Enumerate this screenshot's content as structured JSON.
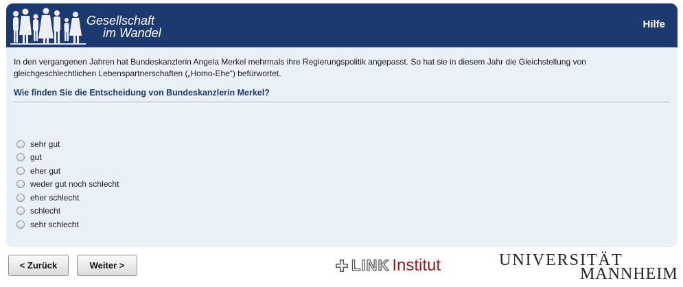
{
  "header": {
    "logo_line1": "Gesellschaft",
    "logo_line2": "im Wandel",
    "help_label": "Hilfe"
  },
  "question": {
    "intro": "In den vergangenen Jahren hat Bundeskanzlerin Angela Merkel mehrmals ihre Regierungspolitik angepasst. So hat sie in diesem Jahr die Gleichstellung von gleichgeschlechtlichen Lebenspartnerschaften („Homo-Ehe“) befürwortet.",
    "text": "Wie finden Sie die Entscheidung von Bundeskanzlerin Merkel?",
    "options": [
      "sehr gut",
      "gut",
      "eher gut",
      "weder gut noch schlecht",
      "eher schlecht",
      "schlecht",
      "sehr schlecht"
    ]
  },
  "nav": {
    "back_label": "< Zurück",
    "next_label": "Weiter >"
  },
  "footer": {
    "link_word": "LINK",
    "institut_word": "Institut",
    "uni_line1": "UNIVERSITÄT",
    "uni_line2": "MANNHEIM"
  },
  "colors": {
    "header_bg": "#1d3a6e",
    "panel_bg": "#e9f0f8",
    "question_text": "#1d3a6e",
    "institut_red": "#8a1c1c"
  },
  "icons": {
    "logo": "people-silhouette-icon",
    "link_mark": "cross-icon"
  }
}
